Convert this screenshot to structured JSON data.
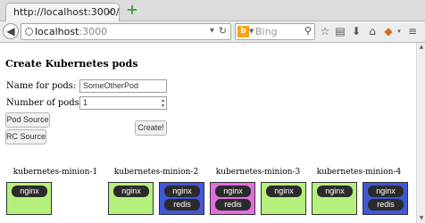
{
  "browser": {
    "tab_title": "http://localhost:3000/",
    "tab_close": "×",
    "new_tab": "+",
    "back": "◀",
    "url_host": "localhost",
    "url_port": ":3000",
    "url_arrow": "▾",
    "url_reload": "↻",
    "search_engine_icon": "b",
    "search_placeholder": "Bing",
    "search_icon": "🔍",
    "toolbar_icons": [
      "star-icon",
      "clipboard-icon",
      "download-icon",
      "home-icon",
      "extension-icon",
      "menu-icon"
    ]
  },
  "page": {
    "title": "Create Kubernetes pods",
    "name_label": "Name for pods:",
    "name_value": "SomeOtherPod",
    "count_label": "Number of pods:",
    "count_value": "1",
    "pod_source_label": "Pod Source",
    "rc_source_label": "RC Source",
    "create_label": "Create!"
  },
  "minions": [
    {
      "name": "kubernetes-minion-1",
      "boxes": [
        {
          "color": "#b6f07c",
          "pods": [
            "nginx"
          ]
        }
      ]
    },
    {
      "name": "kubernetes-minion-2",
      "boxes": [
        {
          "color": "#b6f07c",
          "pods": [
            "nginx"
          ]
        },
        {
          "color": "#3f57d8",
          "pods": [
            "nginx",
            "redis"
          ]
        }
      ]
    },
    {
      "name": "kubernetes-minion-3",
      "boxes": [
        {
          "color": "#e26ede",
          "pods": [
            "nginx",
            "redis"
          ]
        },
        {
          "color": "#b6f07c",
          "pods": [
            "nginx"
          ]
        }
      ]
    },
    {
      "name": "kubernetes-minion-4",
      "boxes": [
        {
          "color": "#b6f07c",
          "pods": [
            "nginx"
          ]
        },
        {
          "color": "#3f57d8",
          "pods": [
            "nginx",
            "redis"
          ]
        }
      ]
    }
  ]
}
